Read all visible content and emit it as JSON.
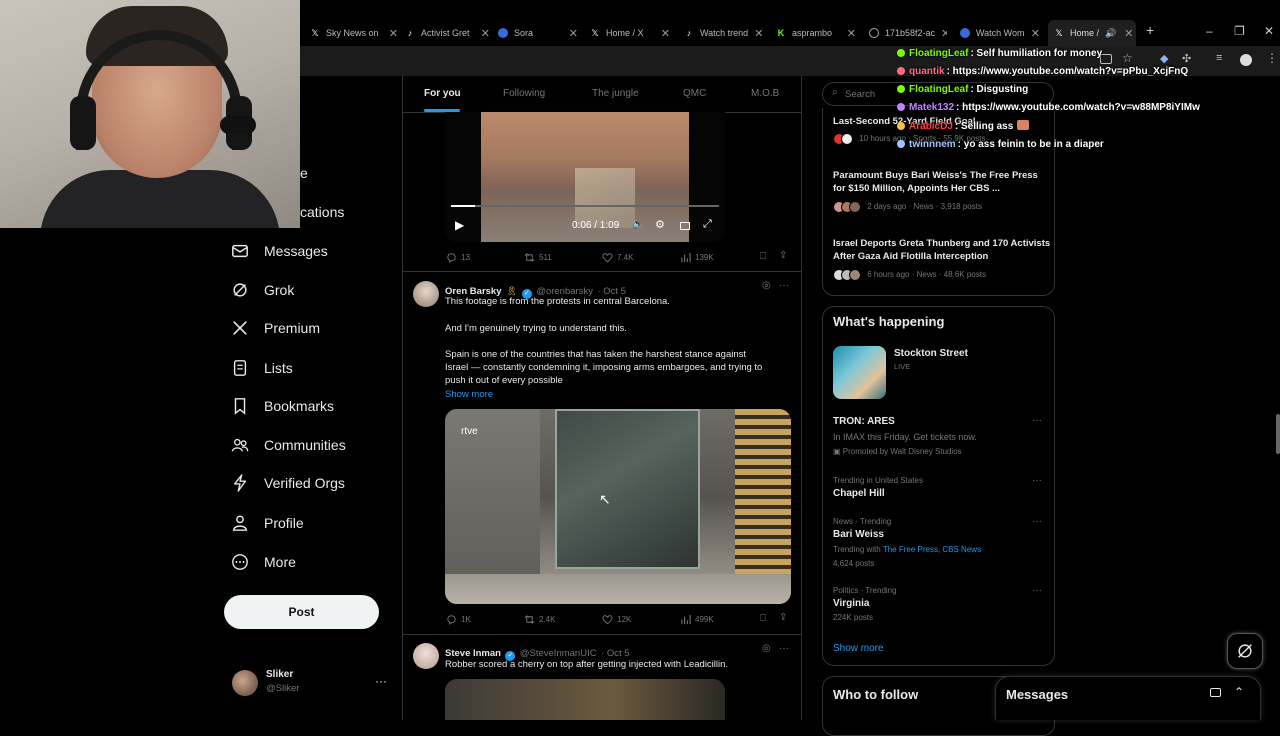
{
  "browser": {
    "tabs": [
      {
        "label": "Sky News on",
        "icon": "x-icon"
      },
      {
        "label": "Activist Gret",
        "icon": "tiktok-icon"
      },
      {
        "label": "Sora",
        "icon": "sora-icon"
      },
      {
        "label": "Home / X",
        "icon": "x-icon"
      },
      {
        "label": "Watch trend",
        "icon": "tiktok-icon"
      },
      {
        "label": "asprambo",
        "icon": "kick-icon"
      },
      {
        "label": "171b58f2-ac",
        "icon": "globe-icon"
      },
      {
        "label": "Watch Wom",
        "icon": "sora-icon"
      },
      {
        "label": "Home /",
        "icon": "x-icon"
      }
    ],
    "new_tab": "+",
    "window_controls": [
      "–",
      "❐",
      "✕"
    ]
  },
  "nav": {
    "partial_items": [
      {
        "label": "e"
      },
      {
        "label": "cations"
      }
    ],
    "items": [
      {
        "label": "Messages",
        "icon": "mail-icon"
      },
      {
        "label": "Grok",
        "icon": "grok-icon"
      },
      {
        "label": "Premium",
        "icon": "x-logo-icon"
      },
      {
        "label": "Lists",
        "icon": "list-icon"
      },
      {
        "label": "Bookmarks",
        "icon": "bookmark-icon"
      },
      {
        "label": "Communities",
        "icon": "people-icon"
      },
      {
        "label": "Verified Orgs",
        "icon": "lightning-icon"
      },
      {
        "label": "Profile",
        "icon": "person-icon"
      },
      {
        "label": "More",
        "icon": "more-circle-icon"
      }
    ],
    "post_label": "Post",
    "account": {
      "name": "Sliker",
      "handle": "@Sliker",
      "more": "···"
    }
  },
  "feed": {
    "tabs": [
      "For you",
      "Following",
      "The jungle",
      "QMC",
      "M.O.B"
    ],
    "video": {
      "time": "0:06 / 1:09"
    },
    "tweet0_metrics": {
      "replies": "13",
      "reposts": "511",
      "likes": "7.4K",
      "views": "139K"
    },
    "tweet1": {
      "name": "Oren Barsky",
      "handle": "@orenbarsky",
      "date": "· Oct 5",
      "line1": "This footage is from the protests in central Barcelona.",
      "line2": "And I'm genuinely trying to understand this.",
      "line3": "Spain is one of the countries that has taken the harshest stance against",
      "line4": "Israel — constantly condemning it, imposing arms embargoes, and trying to",
      "line5": "push it out of every possible",
      "show_more": "Show more",
      "media_watermark": "rtve",
      "metrics": {
        "replies": "1K",
        "reposts": "2.4K",
        "likes": "12K",
        "views": "499K"
      }
    },
    "tweet2": {
      "name": "Steve Inman",
      "handle": "@SteveInmanUIC",
      "date": "· Oct 5",
      "text": "Robber scored a cherry on top after getting injected with Leadicillin."
    }
  },
  "right": {
    "search_placeholder": "Search",
    "news": [
      {
        "title": "Last-Second 52-Yard Field Goal",
        "meta": "10 hours ago · Sports · 55.9K posts"
      },
      {
        "title": "Paramount Buys Bari Weiss's The Free Press for $150 Million, Appoints Her CBS ...",
        "meta": "2 days ago · News · 3,918 posts"
      },
      {
        "title": "Israel Deports Greta Thunberg and 170 Activists After Gaza Aid Flotilla Interception",
        "meta": "6 hours ago · News · 48.6K posts"
      }
    ],
    "happening": {
      "title": "What's happening",
      "live_title": "Stockton Street",
      "live_badge": "LIVE",
      "trends": [
        {
          "context": "",
          "name": "TRON: ARES",
          "desc": "In IMAX this Friday. Get tickets now.",
          "promo": "Promoted by Walt Disney Studios"
        },
        {
          "context": "Trending in United States",
          "name": "Chapel Hill"
        },
        {
          "context": "News · Trending",
          "name": "Bari Weiss",
          "with_label": "Trending with ",
          "with_links": "The Free Press, CBS News",
          "posts": "4,624 posts"
        },
        {
          "context": "Politics · Trending",
          "name": "Virginia",
          "posts": "224K posts"
        }
      ],
      "show_more": "Show more"
    },
    "who_to_follow": "Who to follow",
    "messages_drawer": "Messages"
  },
  "chat": [
    {
      "user": "FloatingLeaf",
      "msg": ": Self humiliation for money",
      "color": "#7CFC00"
    },
    {
      "user": "quantik",
      "msg": ": https://www.youtube.com/watch?v=pPbu_XcjFnQ",
      "color": "#ff6b81"
    },
    {
      "user": "FloatingLeaf",
      "msg": ": Disgusting",
      "color": "#7CFC00"
    },
    {
      "user": "Matek132",
      "msg": ": https://www.youtube.com/watch?v=w88MP8iYIMw",
      "color": "#c084fc"
    },
    {
      "user": "ArabicDJ",
      "msg": ": Selling ass",
      "color": "#ff4040"
    },
    {
      "user": "twinnnem",
      "msg": ": yo ass feinin to be in a diaper",
      "color": "#a0c4ff"
    }
  ],
  "colors": {
    "accent": "#1d9bf0",
    "background": "#000000",
    "border": "#2f3336",
    "muted": "#71767b"
  }
}
